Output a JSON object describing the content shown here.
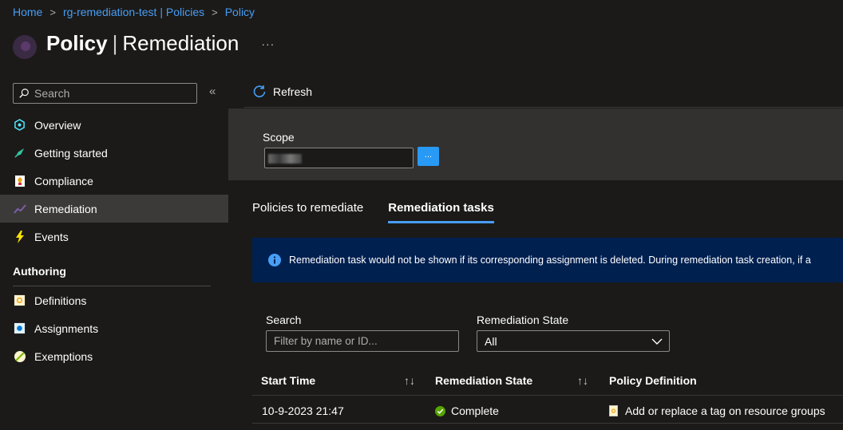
{
  "breadcrumb": {
    "items": [
      "Home",
      "rg-remediation-test | Policies",
      "Policy"
    ],
    "separator": ">"
  },
  "header": {
    "title": "Policy",
    "divider": "|",
    "subtitle": "Remediation",
    "more": "···"
  },
  "sidebar": {
    "search_placeholder": "Search",
    "collapse_glyph": "«",
    "items": [
      {
        "label": "Overview",
        "icon": "overview-icon"
      },
      {
        "label": "Getting started",
        "icon": "rocket-icon"
      },
      {
        "label": "Compliance",
        "icon": "compliance-icon"
      },
      {
        "label": "Remediation",
        "icon": "remediation-icon",
        "active": true
      },
      {
        "label": "Events",
        "icon": "lightning-icon"
      }
    ],
    "section": "Authoring",
    "authoring_items": [
      {
        "label": "Definitions",
        "icon": "definitions-icon"
      },
      {
        "label": "Assignments",
        "icon": "assignments-icon"
      },
      {
        "label": "Exemptions",
        "icon": "exemptions-icon"
      }
    ]
  },
  "toolbar": {
    "refresh_label": "Refresh"
  },
  "scope": {
    "label": "Scope",
    "browse_button": "..."
  },
  "tabs": [
    {
      "label": "Policies to remediate",
      "active": false
    },
    {
      "label": "Remediation tasks",
      "active": true
    }
  ],
  "info": {
    "message": "Remediation task would not be shown if its corresponding assignment is deleted. During remediation task creation, if a"
  },
  "filters": {
    "search_label": "Search",
    "search_placeholder": "Filter by name or ID...",
    "state_label": "Remediation State",
    "state_value": "All"
  },
  "table": {
    "columns": [
      "Start Time",
      "Remediation State",
      "Policy Definition"
    ],
    "sort_glyph": "↑↓",
    "rows": [
      {
        "start_time": "10-9-2023 21:47",
        "state": "Complete",
        "policy": "Add or replace a tag on resource groups"
      }
    ]
  },
  "colors": {
    "accent": "#479ef5",
    "button": "#2899f5",
    "info_bg": "#002050",
    "success": "#57a300"
  }
}
